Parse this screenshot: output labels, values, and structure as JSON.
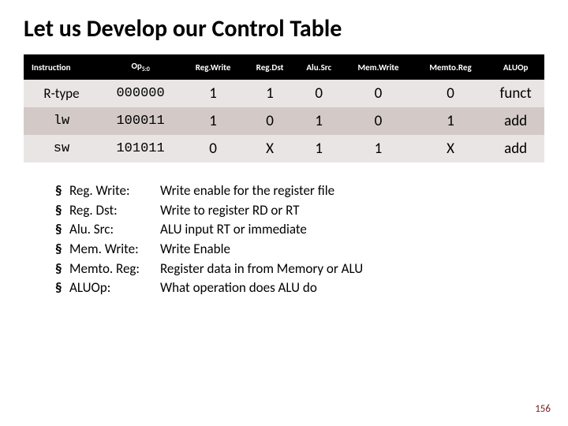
{
  "title": "Let us Develop our Control Table",
  "headers": {
    "instruction": "Instruction",
    "op_base": "Op",
    "op_sub": "5:0",
    "regwrite": "Reg.Write",
    "regdst": "Reg.Dst",
    "alusrc": "Alu.Src",
    "memwrite": "Mem.Write",
    "memtoreg": "Memto.Reg",
    "aluop": "ALUOp"
  },
  "rows": [
    {
      "instr": "R-type",
      "op": "000000",
      "regwrite": "1",
      "regdst": "1",
      "alusrc": "0",
      "memwrite": "0",
      "memtoreg": "0",
      "aluop": "funct",
      "mono": false
    },
    {
      "instr": "lw",
      "op": "100011",
      "regwrite": "1",
      "regdst": "0",
      "alusrc": "1",
      "memwrite": "0",
      "memtoreg": "1",
      "aluop": "add",
      "mono": true
    },
    {
      "instr": "sw",
      "op": "101011",
      "regwrite": "0",
      "regdst": "X",
      "alusrc": "1",
      "memwrite": "1",
      "memtoreg": "X",
      "aluop": "add",
      "mono": true
    }
  ],
  "defs": [
    {
      "term": "Reg. Write:",
      "desc": "Write enable for the register file"
    },
    {
      "term": "Reg. Dst:",
      "desc": "Write to register RD or RT"
    },
    {
      "term": "Alu. Src:",
      "desc": "ALU input RT or immediate"
    },
    {
      "term": "Mem. Write:",
      "desc": "Write Enable"
    },
    {
      "term": "Memto. Reg:",
      "desc": "Register data in from Memory or ALU"
    },
    {
      "term": "ALUOp:",
      "desc": "What operation does ALU do"
    }
  ],
  "bullet": "§",
  "page_number": "156",
  "chart_data": {
    "type": "table",
    "title": "Control Table",
    "columns": [
      "Instruction",
      "Op5:0",
      "Reg.Write",
      "Reg.Dst",
      "Alu.Src",
      "Mem.Write",
      "Memto.Reg",
      "ALUOp"
    ],
    "rows": [
      [
        "R-type",
        "000000",
        "1",
        "1",
        "0",
        "0",
        "0",
        "funct"
      ],
      [
        "lw",
        "100011",
        "1",
        "0",
        "1",
        "0",
        "1",
        "add"
      ],
      [
        "sw",
        "101011",
        "0",
        "X",
        "1",
        "1",
        "X",
        "add"
      ]
    ]
  }
}
